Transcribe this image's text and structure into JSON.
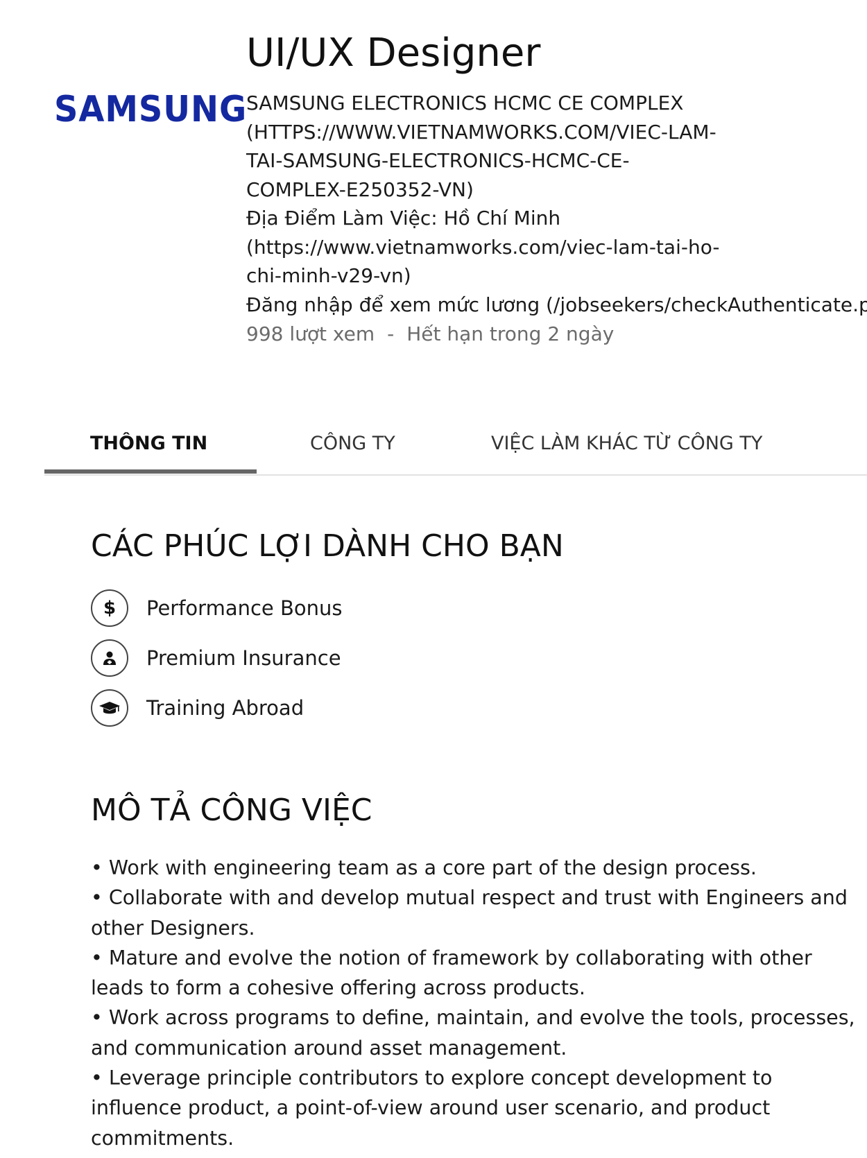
{
  "header": {
    "logo_text": "SAMSUNG",
    "title": "UI/UX Designer",
    "company_lines": [
      "SAMSUNG ELECTRONICS HCMC CE COMPLEX",
      "(HTTPS://WWW.VIETNAMWORKS.COM/VIEC-LAM-",
      "TAI-SAMSUNG-ELECTRONICS-HCMC-CE-",
      "COMPLEX-E250352-VN)"
    ],
    "location_lines": [
      "Địa Điểm Làm Việc: Hồ Chí Minh",
      "(https://www.vietnamworks.com/viec-lam-tai-ho-",
      "chi-minh-v29-vn)"
    ],
    "salary_text": "Đăng nhập để xem mức lương (/jobseekers/checkAuthenticate.php",
    "views": "998 lượt xem",
    "separator": "-",
    "expiry": "Hết hạn trong 2 ngày"
  },
  "tabs": [
    {
      "label": "THÔNG TIN",
      "active": true
    },
    {
      "label": "CÔNG TY",
      "active": false
    },
    {
      "label": "VIỆC LÀM KHÁC TỪ CÔNG TY",
      "active": false
    }
  ],
  "benefits": {
    "heading": "CÁC PHÚC LỢI DÀNH CHO BẠN",
    "items": [
      {
        "label": "Performance Bonus",
        "icon": "dollar-icon"
      },
      {
        "label": "Premium Insurance",
        "icon": "doctor-icon"
      },
      {
        "label": "Training Abroad",
        "icon": "graduation-cap-icon"
      }
    ]
  },
  "description": {
    "heading": "MÔ TẢ CÔNG VIỆC",
    "lines": [
      "• Work with engineering team as a core part of the design process.",
      "• Collaborate with and develop mutual respect and trust with Engineers and",
      "other Designers.",
      "• Mature and evolve the notion of framework by collaborating with other",
      "leads to form a cohesive offering across products.",
      "• Work across programs to define, maintain, and evolve the tools, processes,",
      "and communication around asset management.",
      "• Leverage principle contributors to explore concept development to",
      "influence product, a point-of-view around user scenario, and product",
      "commitments."
    ]
  }
}
